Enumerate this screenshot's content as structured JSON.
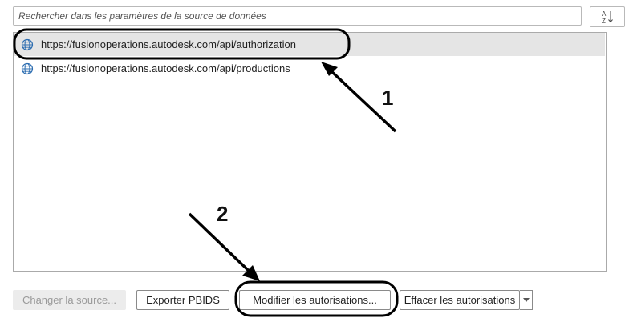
{
  "search": {
    "placeholder": "Rechercher dans les paramètres de la source de données"
  },
  "sort_button": {
    "icon": "sort-az-icon"
  },
  "sources": [
    {
      "url": "https://fusionoperations.autodesk.com/api/authorization",
      "icon": "globe-icon",
      "selected": true
    },
    {
      "url": "https://fusionoperations.autodesk.com/api/productions",
      "icon": "globe-icon",
      "selected": false
    }
  ],
  "buttons": {
    "change_source": "Changer la source...",
    "export_pbids": "Exporter PBIDS",
    "edit_permissions": "Modifier les autorisations...",
    "clear_permissions": "Effacer les autorisations"
  },
  "annotations": {
    "step1": "1",
    "step2": "2"
  },
  "colors": {
    "selection": "#e5e5e5",
    "globe": "#2b6cb0",
    "annotation": "#000000"
  }
}
